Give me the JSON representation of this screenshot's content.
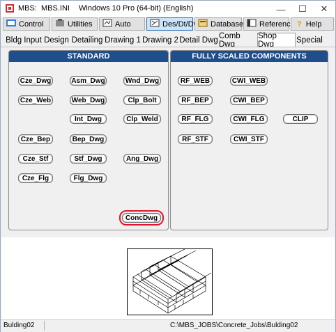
{
  "titlebar": {
    "app": "MBS:",
    "file": "MBS.INI",
    "os": "Windows 10 Pro (64-bit) (English)",
    "minimize": "—",
    "maximize": "☐",
    "close": "✕"
  },
  "toolbar": {
    "control": "Control",
    "utilities": "Utilities",
    "auto": "Auto",
    "desdtdwg": "Des/Dt/Dwg",
    "database": "Database",
    "reference": "Reference",
    "help": "Help"
  },
  "tabs": [
    "Bldg Input",
    "Design",
    "Detailing",
    "Drawing 1",
    "Drawing 2",
    "Detail Dwg",
    "Comb Dwg",
    "Shop Dwg",
    "Special"
  ],
  "active_tab": "Shop Dwg",
  "standard": {
    "title": "STANDARD",
    "buttons": {
      "cze_dwg": "Cze_Dwg",
      "asm_dwg": "Asm_Dwg",
      "wnd_dwg": "Wnd_Dwg",
      "cze_web": "Cze_Web",
      "web_dwg": "Web_Dwg",
      "clp_bolt": "Clp_Bolt",
      "int_dwg": "Int_Dwg",
      "clp_weld": "Clp_Weld",
      "cze_bep": "Cze_Bep",
      "bep_dwg": "Bep_Dwg",
      "cze_stf": "Cze_Stf",
      "stf_dwg": "Stf_Dwg",
      "ang_dwg": "Ang_Dwg",
      "cze_flg": "Cze_Flg",
      "flg_dwg": "Flg_Dwg",
      "concdwg": "ConcDwg"
    }
  },
  "scaled": {
    "title": "FULLY SCALED COMPONENTS",
    "buttons": {
      "rf_web": "RF_WEB",
      "cwi_web": "CWI_WEB",
      "rf_bep": "RF_BEP",
      "cwi_bep": "CWI_BEP",
      "rf_flg": "RF_FLG",
      "cwi_flg": "CWI_FLG",
      "clip": "CLIP",
      "rf_stf": "RF_STF",
      "cwi_stf": "CWI_STF"
    }
  },
  "status": {
    "left": "Bulding02",
    "path": "C:\\MBS_JOBS\\Concrete_Jobs\\Bulding02"
  },
  "colors": {
    "panel_header": "#1f4e8c",
    "selected_outline": "#e0152b",
    "active_toolbar": "#cce4f7"
  }
}
